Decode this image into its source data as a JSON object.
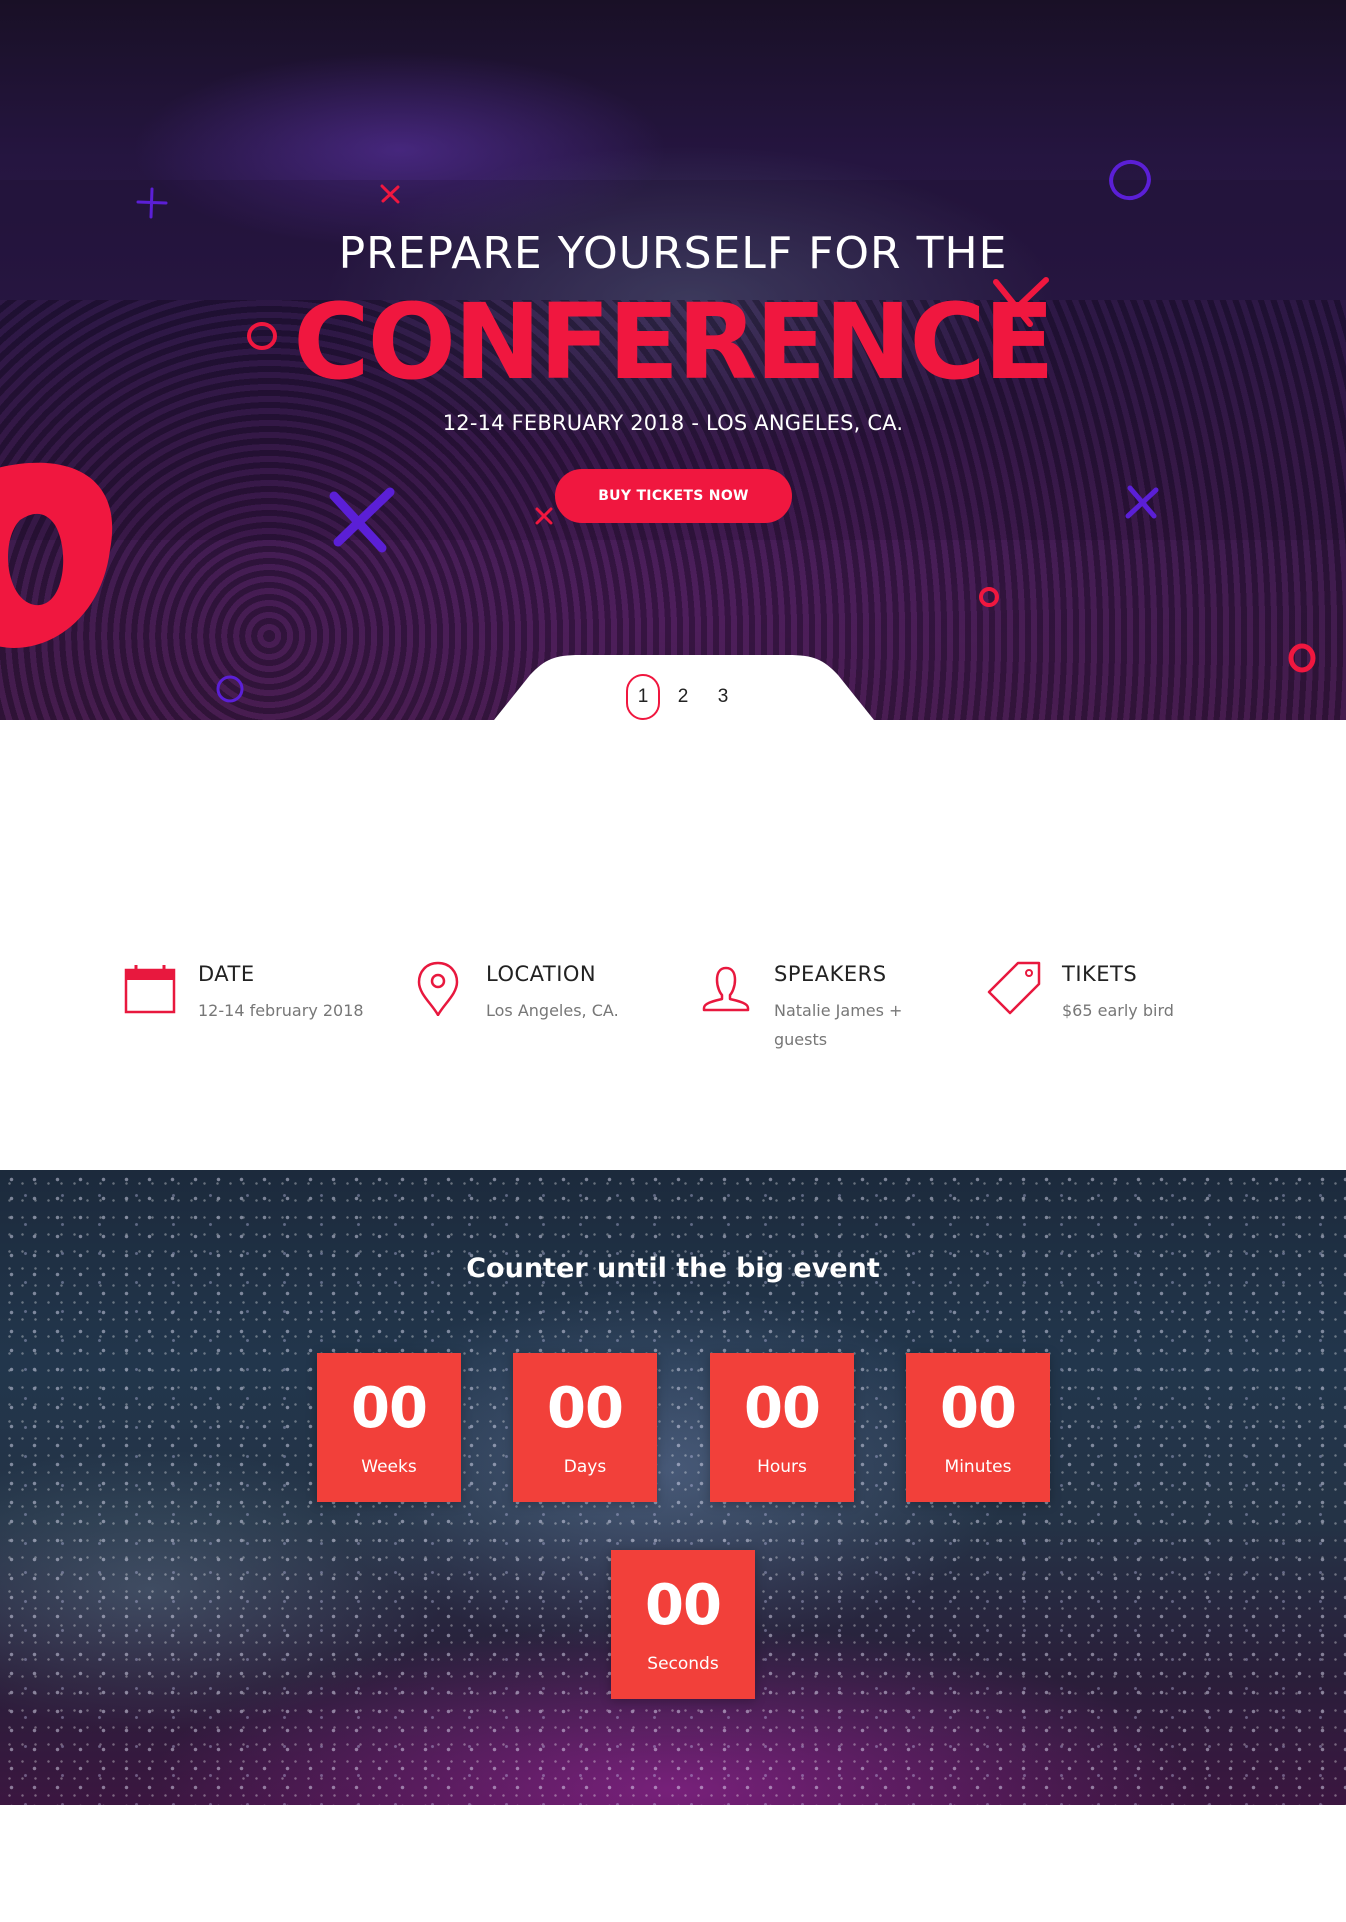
{
  "hero": {
    "kicker": "PREPARE YOURSELF FOR THE",
    "title": "CONFERENCE",
    "date_location": "12-14 FEBRUARY 2018 - LOS ANGELES, CA.",
    "cta_label": "BUY TICKETS NOW",
    "slides": [
      "1",
      "2",
      "3"
    ],
    "active_slide": "1",
    "accent_color": "#f0173f",
    "decor_color": "#5b1fd6"
  },
  "info": {
    "items": [
      {
        "icon": "calendar-icon",
        "label": "DATE",
        "sub": "12-14 february 2018"
      },
      {
        "icon": "location-pin-icon",
        "label": "LOCATION",
        "sub": "Los Angeles, CA."
      },
      {
        "icon": "person-icon",
        "label": "SPEAKERS",
        "sub": "Natalie James + guests"
      },
      {
        "icon": "price-tag-icon",
        "label": "TIKETS",
        "sub": "$65 early bird"
      }
    ],
    "icon_color": "#e8183e"
  },
  "countdown": {
    "title": "Counter until the big event",
    "box_color": "#f2403a",
    "units": [
      {
        "value": "00",
        "label": "Weeks"
      },
      {
        "value": "00",
        "label": "Days"
      },
      {
        "value": "00",
        "label": "Hours"
      },
      {
        "value": "00",
        "label": "Minutes"
      },
      {
        "value": "00",
        "label": "Seconds"
      }
    ]
  }
}
